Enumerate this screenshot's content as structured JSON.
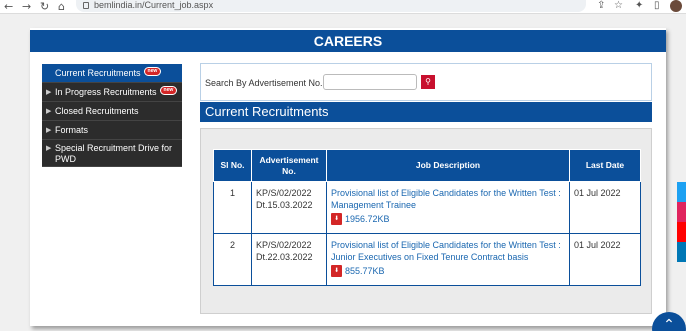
{
  "browser": {
    "back_icon": "back-arrow-icon",
    "forward_icon": "forward-arrow-icon",
    "reload_icon": "reload-icon",
    "home_icon": "home-icon",
    "url": "bemlindia.in/Current_job.aspx"
  },
  "page": {
    "banner_title": "CAREERS",
    "sidebar": {
      "items": [
        {
          "label": "Current Recruitments",
          "badge": "new"
        },
        {
          "label": "In Progress Recruitments",
          "badge": "new"
        },
        {
          "label": "Closed Recruitments"
        },
        {
          "label": "Formats"
        },
        {
          "label": "Special Recruitment Drive for PWD"
        }
      ]
    },
    "search": {
      "label": "Search By Advertisement No. :",
      "value": "",
      "button_icon": "search-icon"
    },
    "section_title": "Current Recruitments",
    "table": {
      "headers": [
        "Sl No.",
        "Advertisement No.",
        "Job Description",
        "Last Date"
      ],
      "rows": [
        {
          "sl": "1",
          "adv": "KP/S/02/2022 Dt.15.03.2022",
          "desc": "Provisional list of Eligible Candidates for the Written Test : Management Trainee",
          "file_size": "1956.72KB",
          "last_date": "01 Jul 2022"
        },
        {
          "sl": "2",
          "adv": "KP/S/02/2022 Dt.22.03.2022",
          "desc": "Provisional list of Eligible Candidates for the Written Test : Junior Executives on Fixed Tenure Contract basis",
          "file_size": "855.77KB",
          "last_date": "01 Jul 2022"
        }
      ]
    }
  },
  "colors": {
    "primary": "#0b4f9a",
    "sidebar_bg": "#2c2c2c",
    "accent_red": "#c8102e",
    "link": "#1a67b0"
  }
}
